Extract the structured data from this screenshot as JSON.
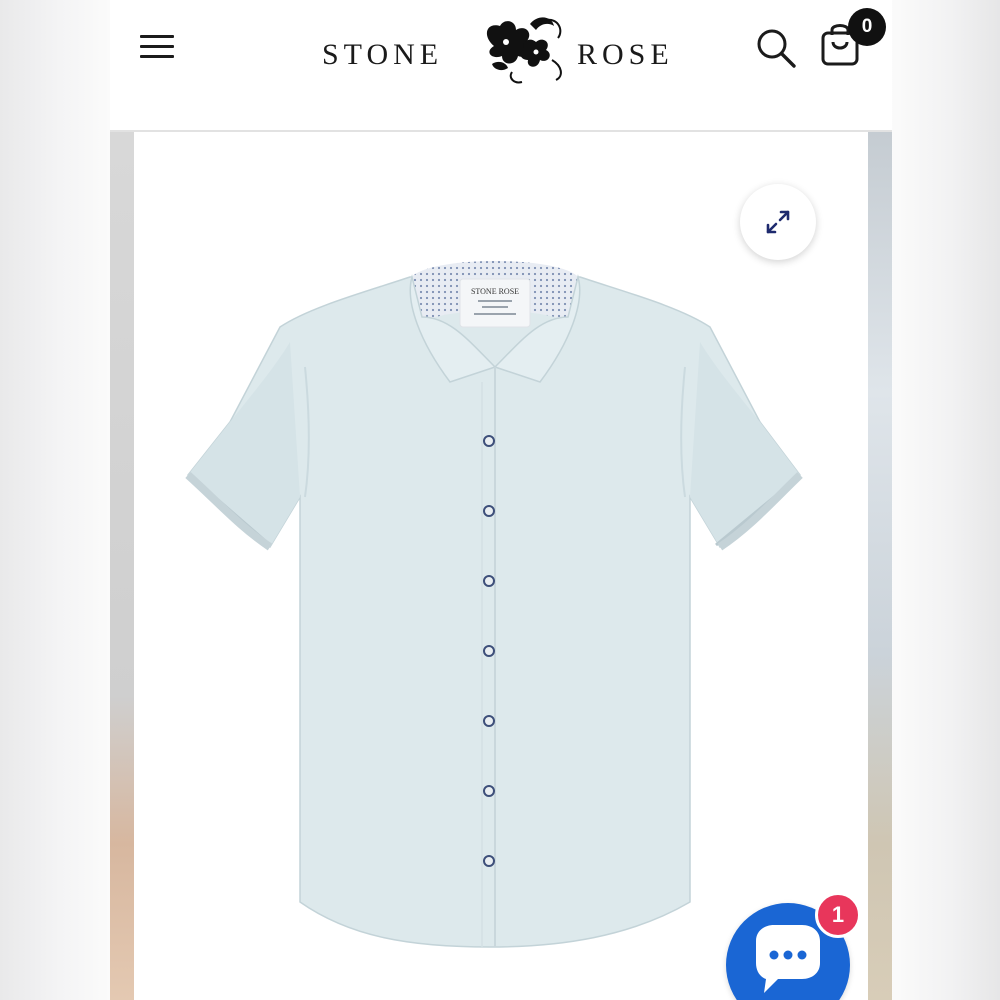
{
  "header": {
    "brand_left": "Stone",
    "brand_right": "Rose",
    "menu_icon": "hamburger-menu-icon",
    "search_icon": "search-icon",
    "cart_icon": "shopping-bag-icon",
    "cart_count": "0"
  },
  "gallery": {
    "product_image": "light blue short sleeve button-up shirt",
    "zoom_icon": "expand-arrows-icon",
    "shirt_color": "#dde9ec",
    "collar_label": "STONE ROSE"
  },
  "chat": {
    "icon": "chat-bubble-icon",
    "badge_count": "1",
    "color": "#1a66d4",
    "badge_color": "#e8365b"
  }
}
